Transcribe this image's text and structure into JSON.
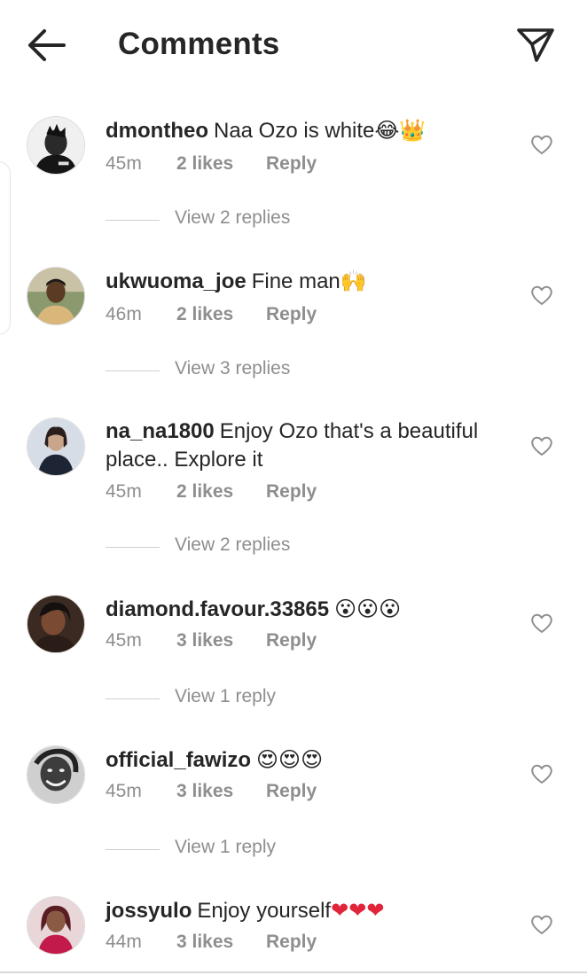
{
  "header": {
    "title": "Comments",
    "back_icon": "arrow-left-icon",
    "share_icon": "paper-plane-icon"
  },
  "colors": {
    "text": "#262626",
    "secondary": "#8e8e8e",
    "heart": "#e0243a"
  },
  "comments": [
    {
      "username": "dmontheo",
      "text": "Naa Ozo is white",
      "emojis": "😂👑",
      "time": "45m",
      "likes": "2 likes",
      "reply": "Reply",
      "view_replies": "View 2 replies"
    },
    {
      "username": "ukwuoma_joe",
      "text": "Fine man",
      "emojis": "🙌",
      "time": "46m",
      "likes": "2 likes",
      "reply": "Reply",
      "view_replies": "View 3 replies"
    },
    {
      "username": "na_na1800",
      "text": "Enjoy Ozo that's a beautiful place.. Explore it",
      "emojis": "",
      "time": "45m",
      "likes": "2 likes",
      "reply": "Reply",
      "view_replies": "View 2 replies"
    },
    {
      "username": "diamond.favour.33865",
      "text": "",
      "emojis": "😮😮😮",
      "time": "45m",
      "likes": "3 likes",
      "reply": "Reply",
      "view_replies": "View 1 reply"
    },
    {
      "username": "official_fawizo",
      "text": "",
      "emojis": "😍😍😍",
      "time": "45m",
      "likes": "3 likes",
      "reply": "Reply",
      "view_replies": "View 1 reply"
    },
    {
      "username": "jossyulo",
      "text": "Enjoy yourself",
      "emojis": "❤❤❤",
      "time": "44m",
      "likes": "3 likes",
      "reply": "Reply",
      "view_replies": ""
    }
  ]
}
